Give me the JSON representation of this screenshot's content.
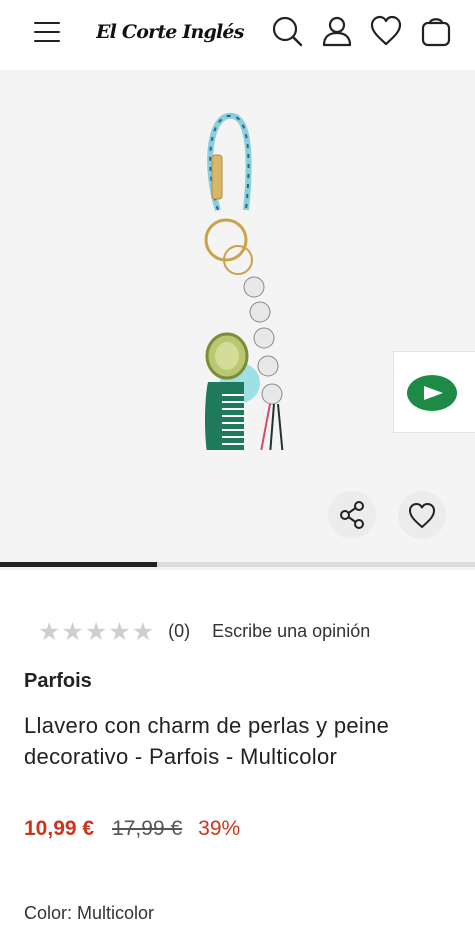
{
  "header": {
    "logo_text": "El Corte Inglés",
    "icons": [
      "menu-icon",
      "search-icon",
      "user-icon",
      "heart-icon",
      "bag-icon"
    ]
  },
  "gallery": {
    "progress_fraction": 0.33
  },
  "rating": {
    "stars_filled": 0,
    "stars_total": 5,
    "count": "(0)",
    "review_link": "Escribe una opinión"
  },
  "product": {
    "brand": "Parfois",
    "title": "Llavero con charm de perlas y peine decorativo - Parfois - Multicolor",
    "price_now": "10,99 €",
    "price_old": "17,99 €",
    "discount": "39%",
    "color_line": "Color: Multicolor"
  },
  "colors": {
    "sale": "#d0331b",
    "video_green": "#1d8a45"
  }
}
